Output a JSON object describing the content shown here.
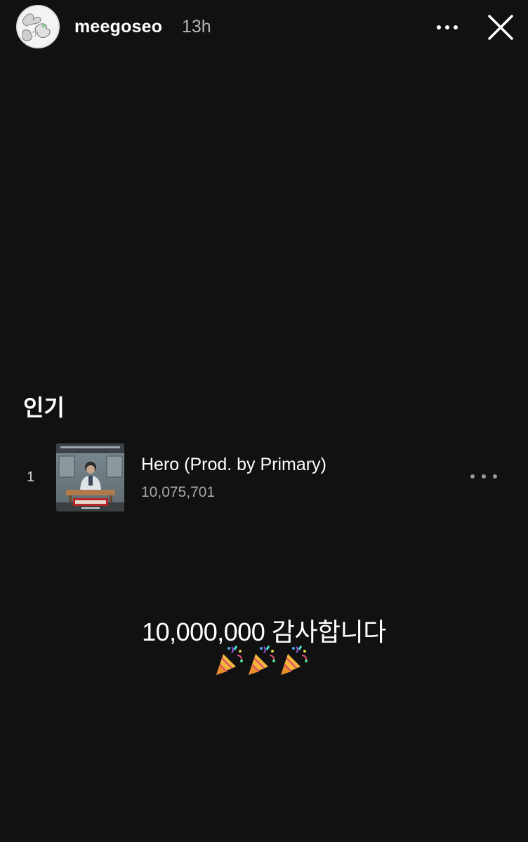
{
  "header": {
    "username": "meegoseo",
    "time_ago": "13h",
    "more_icon": "more-horizontal-icon",
    "close_icon": "close-icon"
  },
  "card": {
    "section_title": "인기",
    "tracks": [
      {
        "rank": "1",
        "title": "Hero (Prod. by Primary)",
        "plays": "10,075,701",
        "more_icon": "more-horizontal-icon"
      }
    ]
  },
  "caption": {
    "text": "10,000,000 감사합니다",
    "emoji": "party-popper-icon",
    "emoji_count": 3
  },
  "colors": {
    "background": "#111112",
    "primary_text": "#ffffff",
    "secondary_text": "#a7a7a7",
    "timestamp_text": "#b5b5b5"
  }
}
